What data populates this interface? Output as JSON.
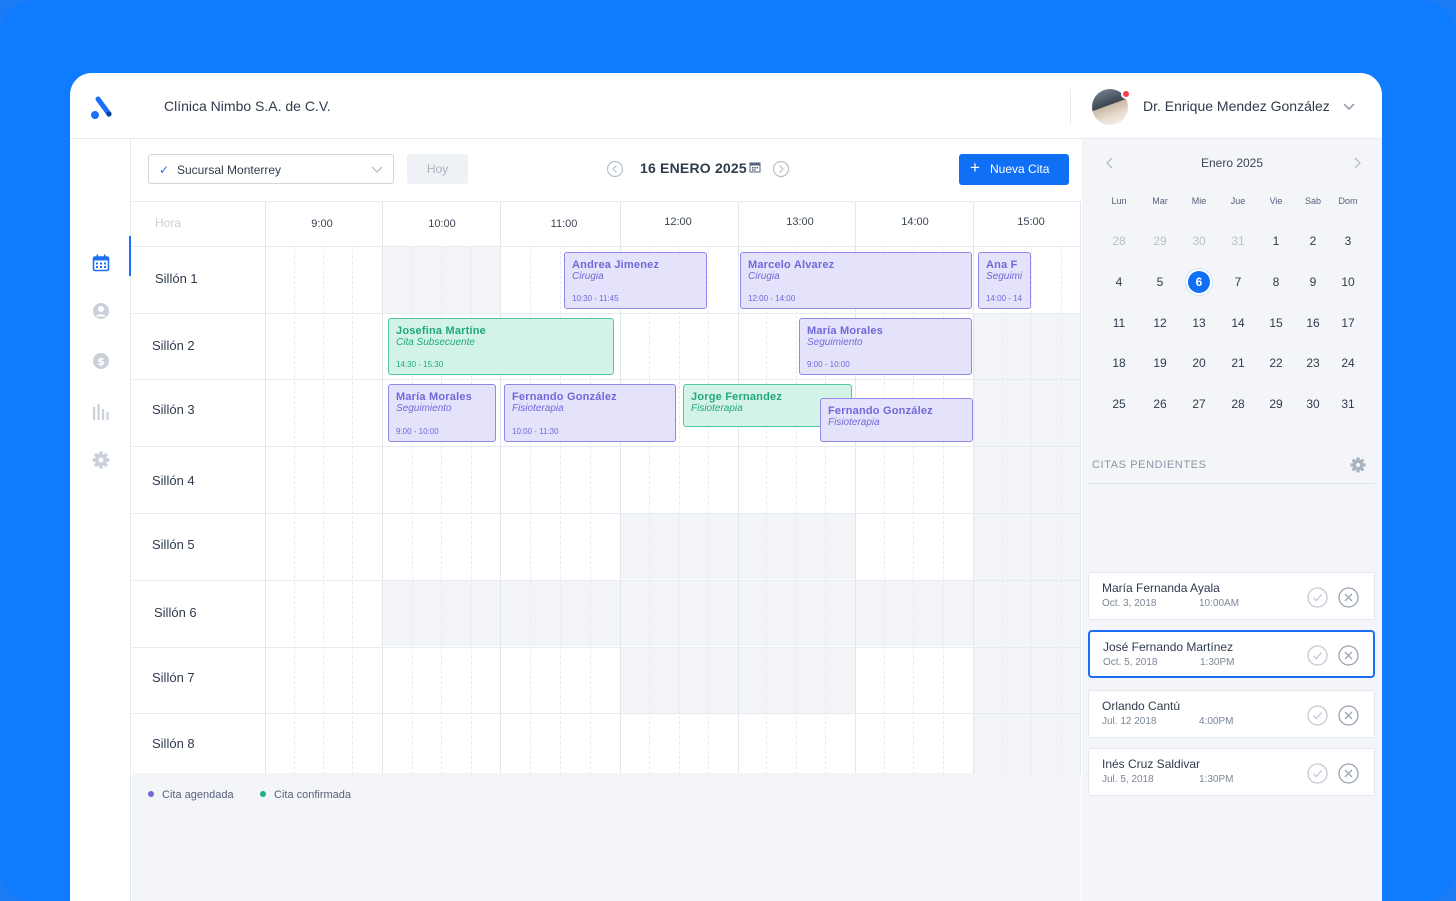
{
  "header": {
    "clinic_name": "Clínica Nimbo S.A. de C.V.",
    "user_name": "Dr. Enrique Mendez González"
  },
  "toolbar": {
    "branch": "Sucursal Monterrey",
    "today_label": "Hoy",
    "current_date": "16 ENERO 2025",
    "new_button": "Nueva Cita"
  },
  "schedule": {
    "hour_header": "Hora",
    "hours": [
      "9:00",
      "10:00",
      "11:00",
      "12:00",
      "13:00",
      "14:00",
      "15:00"
    ],
    "chairs": [
      "Sillón 1",
      "Sillón 2",
      "Sillón 3",
      "Sillón 4",
      "Sillón 5",
      "Sillón 6",
      "Sillón 7",
      "Sillón 8"
    ],
    "appointments": [
      {
        "name": "Andrea Jimenez",
        "type": "Cirugia",
        "time": "10:30 - 11:45",
        "status": "agendada"
      },
      {
        "name": "Marcelo Alvarez",
        "type": "Cirugia",
        "time": "12:00 - 14:00",
        "status": "agendada"
      },
      {
        "name": "Ana F",
        "type": "Seguimi",
        "time": "14:00 - 14",
        "status": "agendada"
      },
      {
        "name": "Josefina Martíne",
        "type": "Cita Subsecuente",
        "time": "14:30 - 15:30",
        "status": "confirmada"
      },
      {
        "name": "María Morales",
        "type": "Seguimiento",
        "time": "9:00 - 10:00",
        "status": "agendada"
      },
      {
        "name": "María Morales",
        "type": "Seguimiento",
        "time": "9:00 - 10:00",
        "status": "agendada"
      },
      {
        "name": "Fernando González",
        "type": "Fisioterapia",
        "time": "10:00 - 11:30",
        "status": "agendada"
      },
      {
        "name": "Jorge Fernandez",
        "type": "Fisioterapia",
        "time": "",
        "status": "confirmada"
      },
      {
        "name": "Fernando González",
        "type": "Fisioterapia",
        "time": "",
        "status": "agendada"
      }
    ]
  },
  "legend": {
    "scheduled": "Cita agendada",
    "confirmed": "Cita confirmada",
    "scheduled_color": "#6f69d8",
    "confirmed_color": "#20b27f"
  },
  "calendar": {
    "month_label": "Enero 2025",
    "weekdays": [
      "Lun",
      "Mar",
      "Mie",
      "Jue",
      "Vie",
      "Sab",
      "Dom"
    ],
    "weeks": [
      [
        "28",
        "29",
        "30",
        "31",
        "1",
        "2",
        "3"
      ],
      [
        "4",
        "5",
        "6",
        "7",
        "8",
        "9",
        "10"
      ],
      [
        "11",
        "12",
        "13",
        "14",
        "15",
        "16",
        "17"
      ],
      [
        "18",
        "19",
        "20",
        "21",
        "22",
        "23",
        "24"
      ],
      [
        "25",
        "26",
        "27",
        "28",
        "29",
        "30",
        "31"
      ]
    ],
    "selected_day": "6",
    "accent": "#1070f5"
  },
  "pending": {
    "title": "CITAS PENDIENTES",
    "items": [
      {
        "name": "María Fernanda Ayala",
        "date": "Oct. 3, 2018",
        "time": "10:00AM"
      },
      {
        "name": "José Fernando Martínez",
        "date": "Oct. 5, 2018",
        "time": "1:30PM"
      },
      {
        "name": "Orlando Cantú",
        "date": "Jul. 12 2018",
        "time": "4:00PM"
      },
      {
        "name": "Inés Cruz Saldivar",
        "date": "Jul. 5, 2018",
        "time": "1:30PM"
      }
    ]
  }
}
